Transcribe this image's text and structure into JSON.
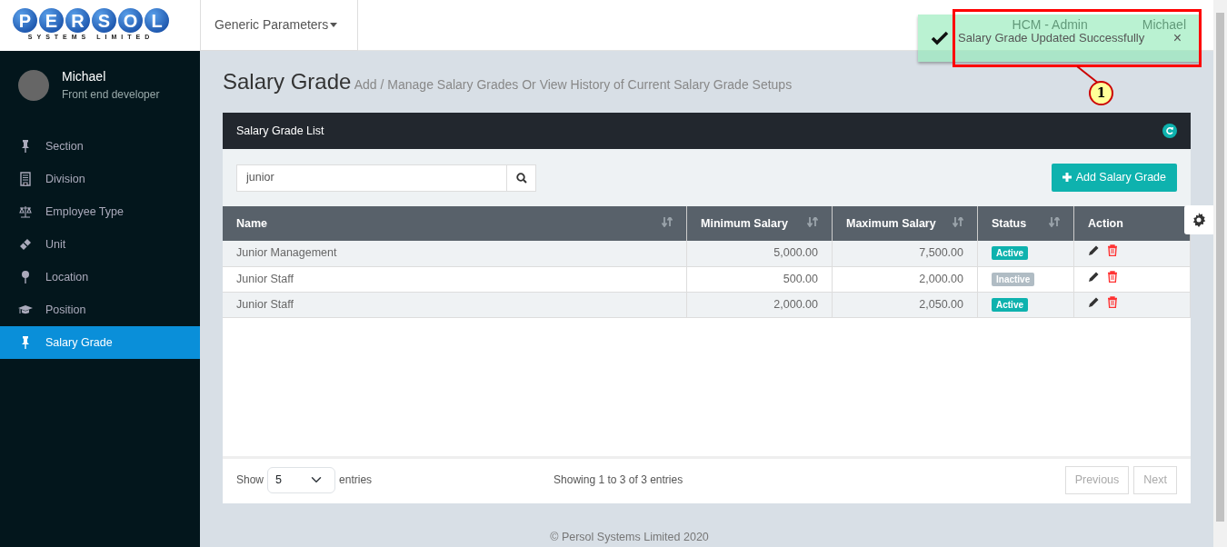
{
  "brand": {
    "logo_letters": [
      "P",
      "E",
      "R",
      "S",
      "O",
      "L"
    ],
    "logo_subtitle": "SYSTEMS LIMITED"
  },
  "topbar": {
    "menu": "Generic Parameters",
    "app": "HCM - Admin",
    "user": "Michael"
  },
  "toast": {
    "message": "Salary Grade Updated Successfully",
    "close": "×"
  },
  "callout": {
    "number": "1"
  },
  "profile": {
    "name": "Michael",
    "role": "Front end developer"
  },
  "sidebar": {
    "items": [
      {
        "label": "Section",
        "selected": false
      },
      {
        "label": "Division",
        "selected": false
      },
      {
        "label": "Employee Type",
        "selected": false
      },
      {
        "label": "Unit",
        "selected": false
      },
      {
        "label": "Location",
        "selected": false
      },
      {
        "label": "Position",
        "selected": false
      },
      {
        "label": "Salary Grade",
        "selected": true
      }
    ]
  },
  "page": {
    "title": "Salary Grade",
    "subtitle": "Add / Manage Salary Grades Or View History of Current Salary Grade Setups"
  },
  "panel": {
    "title": "Salary Grade List",
    "search": {
      "value": "junior"
    },
    "add_button": "Add Salary Grade",
    "table": {
      "columns": [
        {
          "label": "Name"
        },
        {
          "label": "Minimum Salary"
        },
        {
          "label": "Maximum Salary"
        },
        {
          "label": "Status"
        },
        {
          "label": "Action"
        }
      ],
      "rows": [
        {
          "name": "Junior Management",
          "min": "5,000.00",
          "max": "7,500.00",
          "status": "Active",
          "active": true
        },
        {
          "name": "Junior Staff",
          "min": "500.00",
          "max": "2,000.00",
          "status": "Inactive",
          "active": false
        },
        {
          "name": "Junior Staff",
          "min": "2,000.00",
          "max": "2,050.00",
          "status": "Active",
          "active": true
        }
      ]
    },
    "length": {
      "show": "Show",
      "value": "5",
      "entries": "entries"
    },
    "info": "Showing 1 to 3 of 3 entries",
    "pagination": [
      {
        "label": "Previous",
        "disabled": true
      },
      {
        "label": "Next",
        "disabled": true
      }
    ]
  },
  "footer": "© Persol Systems Limited 2020"
}
